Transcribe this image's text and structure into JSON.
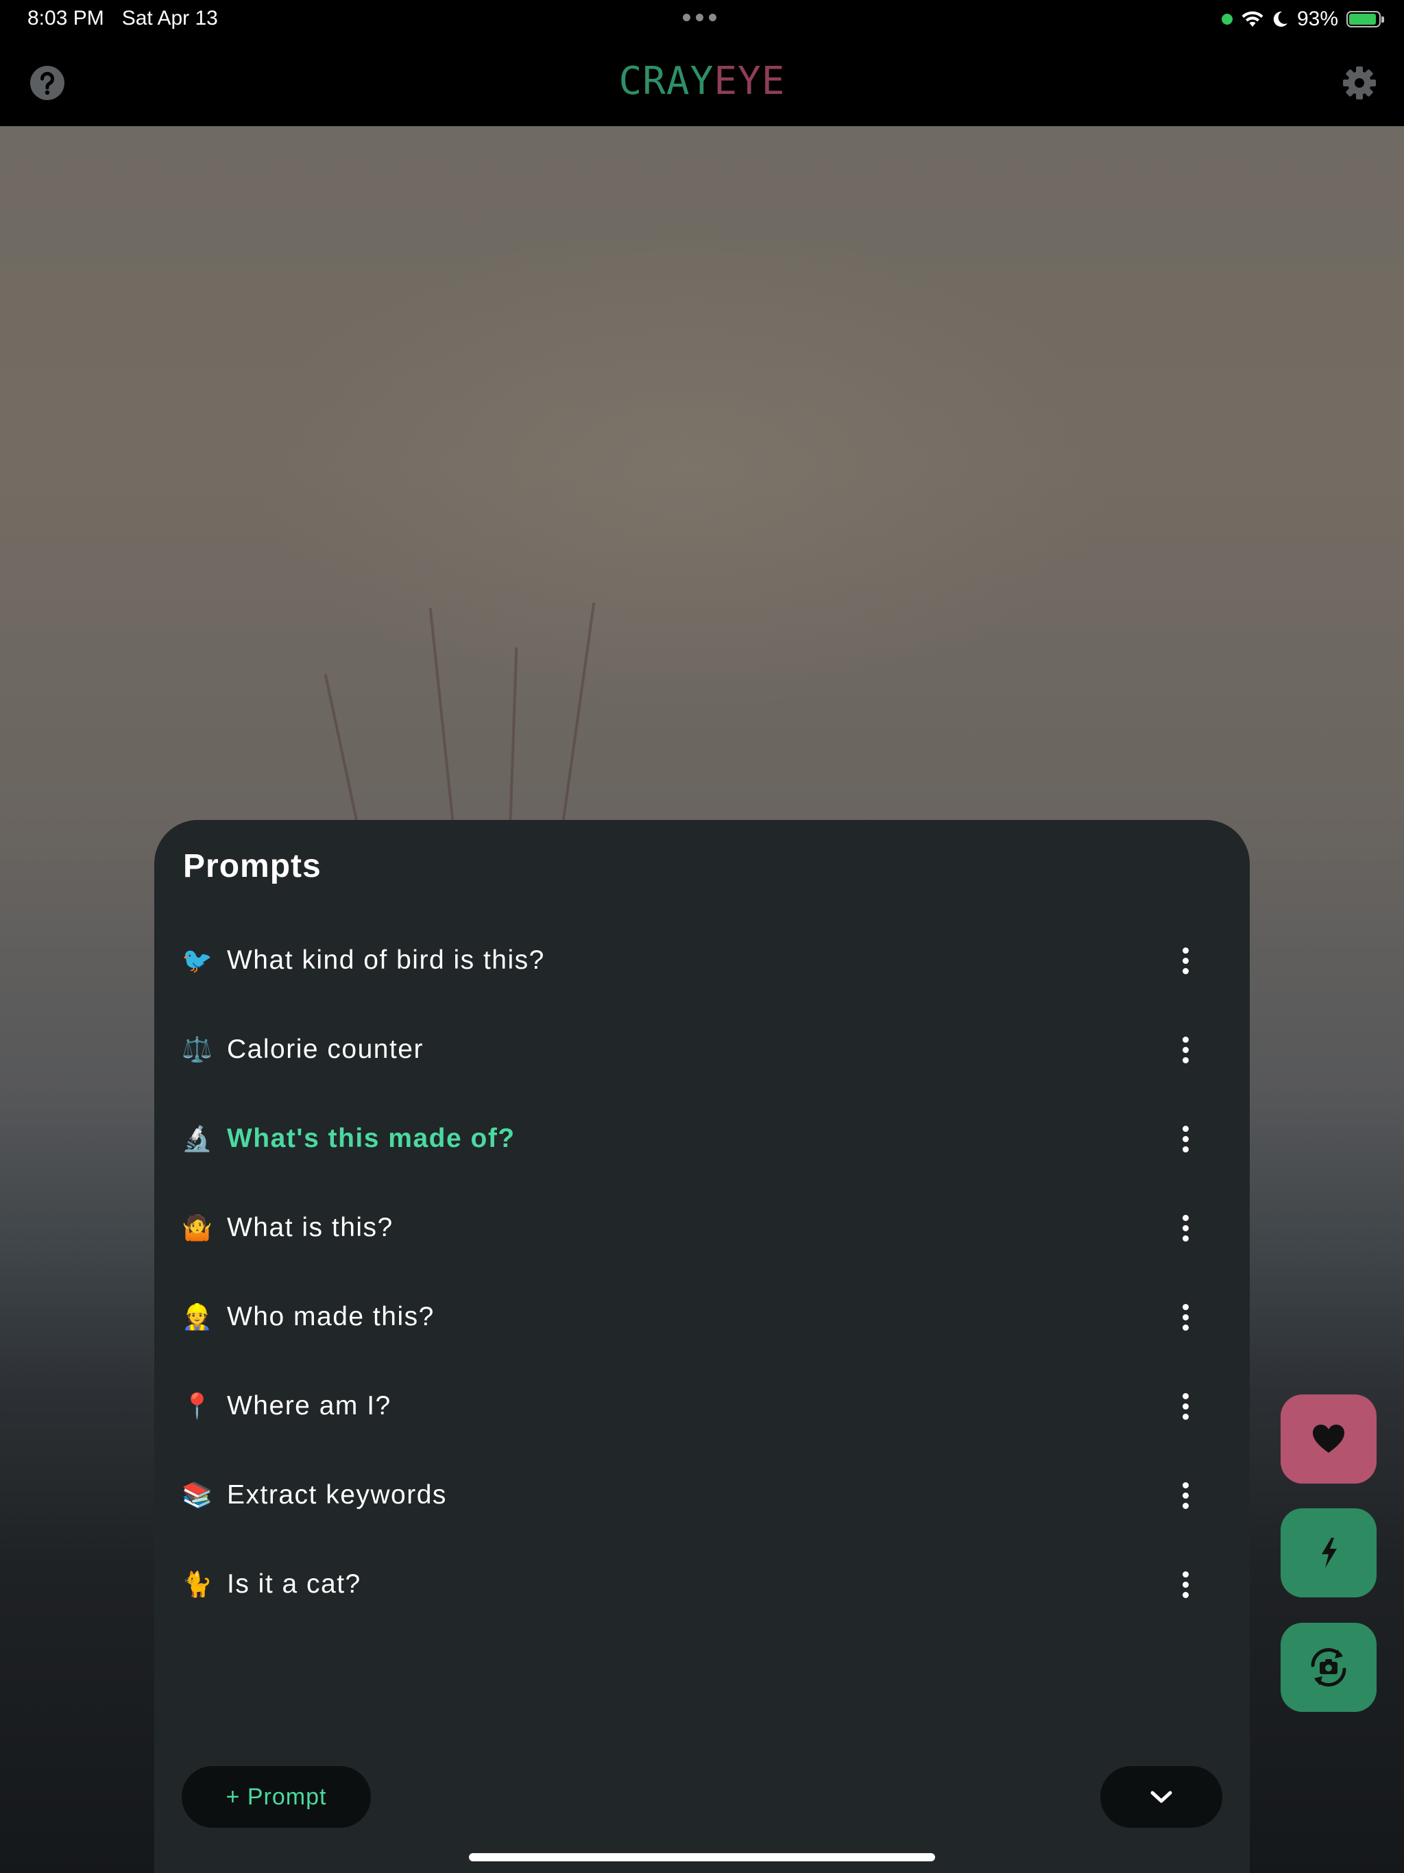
{
  "status_bar": {
    "time": "8:03 PM",
    "date": "Sat Apr 13",
    "battery": "93%",
    "battery_level": 0.93
  },
  "app_bar": {
    "title_part1": "CRAY",
    "title_part2": "EYE",
    "title_color1": "#2f8f66",
    "title_color2": "#8e3e55"
  },
  "sheet": {
    "title": "Prompts",
    "prompts": [
      {
        "emoji": "🐦",
        "label": "What kind of bird is this?",
        "selected": false
      },
      {
        "emoji": "⚖️",
        "label": "Calorie counter",
        "selected": false
      },
      {
        "emoji": "🔬",
        "label": "What's this made of?",
        "selected": true
      },
      {
        "emoji": "🤷",
        "label": "What is this?",
        "selected": false
      },
      {
        "emoji": "👷",
        "label": "Who made this?",
        "selected": false
      },
      {
        "emoji": "📍",
        "label": "Where am I?",
        "selected": false
      },
      {
        "emoji": "📚",
        "label": "Extract keywords",
        "selected": false
      },
      {
        "emoji": "🐈",
        "label": "Is it a cat?",
        "selected": false
      }
    ],
    "add_button_label": "+ Prompt",
    "accent_color": "#4cd9a0"
  },
  "icons": {
    "help": "help-circle-icon",
    "settings": "gear-icon",
    "more": "more-vertical-icon",
    "collapse": "chevron-down-icon",
    "favorite": "heart-icon",
    "flash": "flash-icon",
    "flip_camera": "camera-rotate-icon"
  },
  "colors": {
    "favorite_fab": "#b4546f",
    "action_fab": "#2e8a61",
    "sheet_bg": "#212628"
  }
}
